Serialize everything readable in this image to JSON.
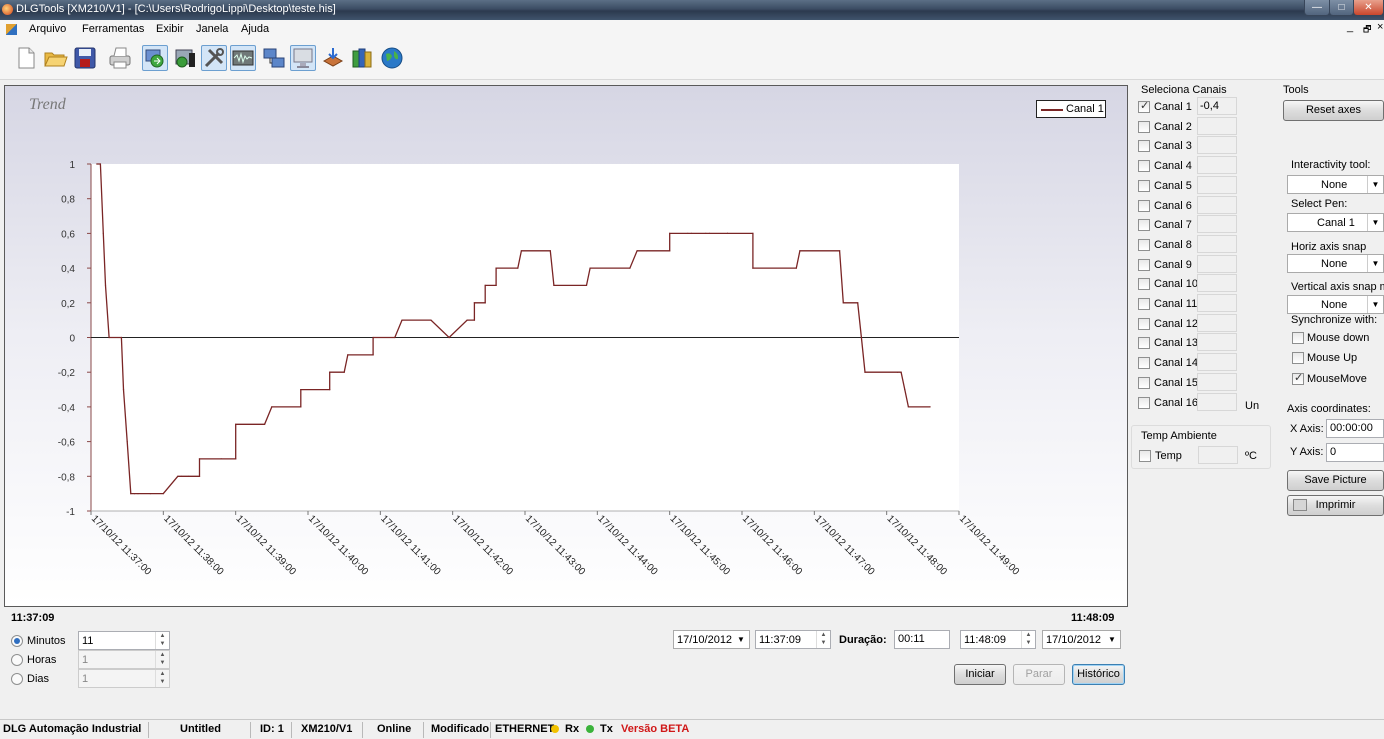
{
  "window": {
    "title": "DLGTools [XM210/V1] - [C:\\Users\\RodrigoLippi\\Desktop\\teste.his]",
    "minimize": "—",
    "maximize": "□",
    "close": "✕",
    "mdi_min": "_",
    "mdi_restore": "🗗",
    "mdi_close": "×"
  },
  "menu": [
    "Arquivo",
    "Ferramentas",
    "Exibir",
    "Janela",
    "Ajuda"
  ],
  "toolbar": {
    "icons": [
      "new-file-icon",
      "open-folder-icon",
      "save-icon",
      "print-icon",
      "sync-icon",
      "audio-icon",
      "tools-icon",
      "waveform-icon",
      "network-icon",
      "monitor-icon",
      "install-icon",
      "books-icon",
      "globe-icon"
    ]
  },
  "chart_data": {
    "type": "line",
    "title": "Trend",
    "ylim": [
      -1,
      1
    ],
    "y_ticks": [
      "1",
      "0,8",
      "0,6",
      "0,4",
      "0,2",
      "0",
      "-0,2",
      "-0,4",
      "-0,6",
      "-0,8",
      "-1"
    ],
    "x_ticks": [
      "17/10/12 11:37:00",
      "17/10/12 11:38:00",
      "17/10/12 11:39:00",
      "17/10/12 11:40:00",
      "17/10/12 11:41:00",
      "17/10/12 11:42:00",
      "17/10/12 11:43:00",
      "17/10/12 11:44:00",
      "17/10/12 11:45:00",
      "17/10/12 11:46:00",
      "17/10/12 11:47:00",
      "17/10/12 11:48:00",
      "17/10/12 11:49:00"
    ],
    "x_unit": "minutes after 11:37:00",
    "legend": "top-right",
    "series": [
      {
        "name": "Canal 1",
        "color": "#7a2525",
        "x": [
          0.08,
          0.13,
          0.17,
          0.2,
          0.25,
          0.42,
          0.45,
          0.5,
          0.55,
          0.6,
          0.65,
          0.82,
          1.0,
          1.2,
          1.25,
          1.35,
          1.5,
          1.5,
          1.8,
          2.0,
          2.0,
          2.4,
          2.5,
          2.9,
          2.9,
          3.3,
          3.3,
          3.5,
          3.55,
          3.9,
          3.9,
          4.2,
          4.3,
          4.7,
          4.95,
          4.95,
          5.2,
          5.3,
          5.3,
          5.45,
          5.45,
          5.6,
          5.6,
          5.9,
          5.95,
          6.35,
          6.4,
          6.85,
          6.9,
          7.45,
          7.55,
          8.0,
          8.0,
          8.25,
          8.3,
          8.5,
          8.55,
          8.8,
          8.8,
          9.15,
          9.15,
          9.75,
          9.8,
          10.35,
          10.4,
          10.6,
          10.65,
          10.65,
          10.7,
          11.15
        ],
        "y": [
          1.0,
          1.0,
          0.6,
          0.3,
          0.0,
          0.0,
          -0.3,
          -0.6,
          -0.9,
          -0.9,
          -0.9,
          -0.9,
          -0.9,
          -0.8,
          -0.8,
          -0.8,
          -0.8,
          -0.7,
          -0.7,
          -0.7,
          -0.5,
          -0.5,
          -0.4,
          -0.4,
          -0.3,
          -0.3,
          -0.2,
          -0.2,
          -0.1,
          -0.1,
          0.0,
          0.0,
          0.1,
          0.1,
          0.0,
          0.0,
          0.1,
          0.1,
          0.2,
          0.2,
          0.3,
          0.3,
          0.4,
          0.4,
          0.5,
          0.5,
          0.3,
          0.3,
          0.4,
          0.4,
          0.5,
          0.5,
          0.6,
          0.6,
          0.6,
          0.6,
          0.6,
          0.6,
          0.6,
          0.6,
          0.4,
          0.4,
          0.5,
          0.5,
          0.2,
          0.2,
          0.0,
          0.0,
          -0.2,
          -0.2
        ]
      }
    ]
  },
  "chart_extra": {
    "tail_x": [
      11.2,
      11.25,
      11.3,
      11.6
    ],
    "tail_y": [
      -0.2,
      -0.3,
      -0.4,
      -0.4
    ]
  },
  "time_range": {
    "start": "11:37:09",
    "end": "11:48:09"
  },
  "channels": {
    "title": "Seleciona Canais",
    "items": [
      {
        "label": "Canal 1",
        "checked": true,
        "value": "-0,4"
      },
      {
        "label": "Canal 2",
        "checked": false,
        "value": ""
      },
      {
        "label": "Canal 3",
        "checked": false,
        "value": ""
      },
      {
        "label": "Canal 4",
        "checked": false,
        "value": ""
      },
      {
        "label": "Canal 5",
        "checked": false,
        "value": ""
      },
      {
        "label": "Canal 6",
        "checked": false,
        "value": ""
      },
      {
        "label": "Canal 7",
        "checked": false,
        "value": ""
      },
      {
        "label": "Canal 8",
        "checked": false,
        "value": ""
      },
      {
        "label": "Canal 9",
        "checked": false,
        "value": ""
      },
      {
        "label": "Canal 10",
        "checked": false,
        "value": ""
      },
      {
        "label": "Canal 11",
        "checked": false,
        "value": ""
      },
      {
        "label": "Canal 12",
        "checked": false,
        "value": ""
      },
      {
        "label": "Canal 13",
        "checked": false,
        "value": ""
      },
      {
        "label": "Canal 14",
        "checked": false,
        "value": ""
      },
      {
        "label": "Canal 15",
        "checked": false,
        "value": ""
      },
      {
        "label": "Canal 16",
        "checked": false,
        "value": ""
      }
    ],
    "unit": "Un"
  },
  "temp": {
    "title": "Temp Ambiente",
    "label": "Temp",
    "unit": "ºC",
    "value": ""
  },
  "tools": {
    "title": "Tools",
    "reset_axes": "Reset axes",
    "interactivity_label": "Interactivity tool:",
    "interactivity_value": "None",
    "select_pen_label": "Select Pen:",
    "select_pen_value": "Canal 1",
    "horiz_snap_label": "Horiz axis snap mode:",
    "horiz_snap_value": "None",
    "vert_snap_label": "Vertical axis snap mode:",
    "vert_snap_value": "None",
    "sync_label": "Synchronize with:",
    "mouse_down": "Mouse down",
    "mouse_up": "Mouse Up",
    "mouse_move": "MouseMove",
    "axis_coords_label": "Axis coordinates:",
    "x_axis_label": "X Axis:",
    "x_axis_value": "00:00:00",
    "y_axis_label": "Y Axis:",
    "y_axis_value": "0",
    "save_picture": "Save Picture",
    "imprimir": "Imprimir"
  },
  "bottom": {
    "minutos_label": "Minutos",
    "minutos_value": "11",
    "horas_label": "Horas",
    "horas_value": "1",
    "dias_label": "Dias",
    "dias_value": "1",
    "start_date": "17/10/2012",
    "start_time": "11:37:09",
    "duracao_label": "Duração:",
    "duracao_value": "00:11",
    "end_time": "11:48:09",
    "end_date": "17/10/2012",
    "iniciar": "Iniciar",
    "parar": "Parar",
    "historico": "Histórico"
  },
  "status": {
    "company": "DLG Automação Industrial",
    "doc": "Untitled",
    "id": "ID: 1",
    "device": "XM210/V1",
    "online": "Online",
    "modified": "Modificado",
    "interface": "ETHERNET",
    "rx": "Rx",
    "tx": "Tx",
    "version": "Versão BETA",
    "rx_color": "#f2c200",
    "tx_color": "#3bb33b",
    "version_color": "#d01818"
  }
}
